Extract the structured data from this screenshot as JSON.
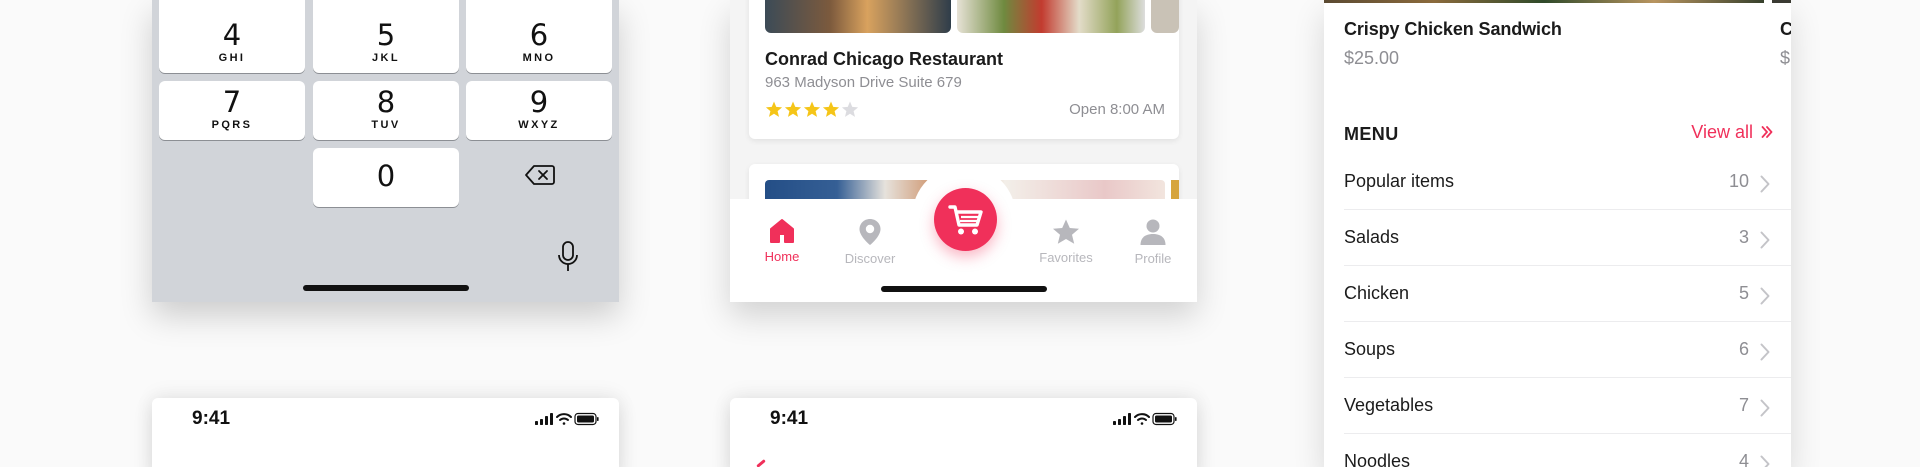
{
  "keypad": {
    "keys": [
      {
        "num": "4",
        "letters": "GHI"
      },
      {
        "num": "5",
        "letters": "JKL"
      },
      {
        "num": "6",
        "letters": "MNO"
      },
      {
        "num": "7",
        "letters": "PQRS"
      },
      {
        "num": "8",
        "letters": "TUV"
      },
      {
        "num": "9",
        "letters": "WXYZ"
      },
      {
        "num": "0",
        "letters": ""
      }
    ]
  },
  "restaurant": {
    "name": "Conrad Chicago Restaurant",
    "address": "963 Madyson Drive Suite 679",
    "rating": 4,
    "rating_max": 5,
    "hours": "Open 8:00 AM"
  },
  "tabbar": {
    "home": "Home",
    "discover": "Discover",
    "favorites": "Favorites",
    "profile": "Profile"
  },
  "menu": {
    "dish_name": "Crispy Chicken Sandwich",
    "dish_price": "$25.00",
    "dish2_name_partial": "C",
    "dish2_price_partial": "$",
    "title": "MENU",
    "view_all": "View all",
    "rows": [
      {
        "label": "Popular items",
        "count": "10"
      },
      {
        "label": "Salads",
        "count": "3"
      },
      {
        "label": "Chicken",
        "count": "5"
      },
      {
        "label": "Soups",
        "count": "6"
      },
      {
        "label": "Vegetables",
        "count": "7"
      },
      {
        "label": "Noodles",
        "count": "4"
      }
    ]
  },
  "status_bar": {
    "time_left": "9:41",
    "time_right": "9:41"
  },
  "colors": {
    "accent": "#f0305a",
    "star": "#f5c518",
    "muted": "#8e8e93"
  }
}
